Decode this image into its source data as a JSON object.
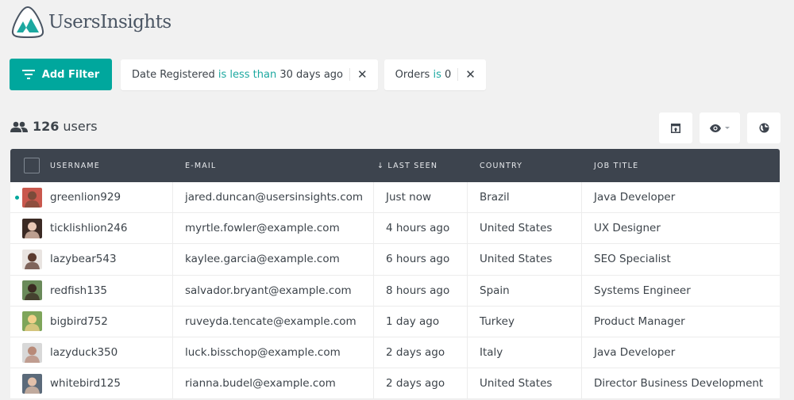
{
  "app": {
    "name": "UsersInsights",
    "brand_color": "#00a79d"
  },
  "filters": {
    "add_filter_label": "Add Filter",
    "active": [
      {
        "field": "Date Registered",
        "operator": "is less than",
        "value": "30 days ago",
        "remove_icon": "close-icon"
      },
      {
        "field": "Orders",
        "operator": "is",
        "value": "0",
        "remove_icon": "close-icon"
      }
    ]
  },
  "summary": {
    "count": "126",
    "label": "users",
    "icon": "users-icon"
  },
  "toolbar": {
    "buttons": [
      {
        "name": "export-button",
        "icon": "export-icon"
      },
      {
        "name": "visible-columns-button",
        "icon": "eye-icon"
      },
      {
        "name": "map-view-button",
        "icon": "globe-icon"
      }
    ]
  },
  "table": {
    "columns": [
      {
        "key": "username",
        "label": "USERNAME"
      },
      {
        "key": "email",
        "label": "E-MAIL"
      },
      {
        "key": "last_seen",
        "label": "↓ LAST SEEN",
        "sorted": "desc"
      },
      {
        "key": "country",
        "label": "COUNTRY"
      },
      {
        "key": "job_title",
        "label": "JOB TITLE"
      }
    ],
    "rows": [
      {
        "username": "greenlion929",
        "email": "jared.duncan@usersinsights.com",
        "last_seen": "Just now",
        "country": "Brazil",
        "job_title": "Java Developer",
        "online": true,
        "avatar_bg": "#c9584d",
        "avatar_fg": "#7a4b3a"
      },
      {
        "username": "ticklishlion246",
        "email": "myrtle.fowler@example.com",
        "last_seen": "4 hours ago",
        "country": "United States",
        "job_title": "UX Designer",
        "online": false,
        "avatar_bg": "#3b2a24",
        "avatar_fg": "#e8c7b4"
      },
      {
        "username": "lazybear543",
        "email": "kaylee.garcia@example.com",
        "last_seen": "6 hours ago",
        "country": "United States",
        "job_title": "SEO Specialist",
        "online": false,
        "avatar_bg": "#e9e4e1",
        "avatar_fg": "#5b3a2e"
      },
      {
        "username": "redfish135",
        "email": "salvador.bryant@example.com",
        "last_seen": "8 hours ago",
        "country": "Spain",
        "job_title": "Systems Engineer",
        "online": false,
        "avatar_bg": "#6a8a5a",
        "avatar_fg": "#3a2a22"
      },
      {
        "username": "bigbird752",
        "email": "ruveyda.tencate@example.com",
        "last_seen": "1 day ago",
        "country": "Turkey",
        "job_title": "Product Manager",
        "online": false,
        "avatar_bg": "#7ea55a",
        "avatar_fg": "#f1d08a"
      },
      {
        "username": "lazyduck350",
        "email": "luck.bisschop@example.com",
        "last_seen": "2 days ago",
        "country": "Italy",
        "job_title": "Java Developer",
        "online": false,
        "avatar_bg": "#d8d8d8",
        "avatar_fg": "#b88a78"
      },
      {
        "username": "whitebird125",
        "email": "rianna.budel@example.com",
        "last_seen": "2 days ago",
        "country": "United States",
        "job_title": "Director Business Development",
        "online": false,
        "avatar_bg": "#5b6a7a",
        "avatar_fg": "#e2c0aa"
      }
    ]
  }
}
